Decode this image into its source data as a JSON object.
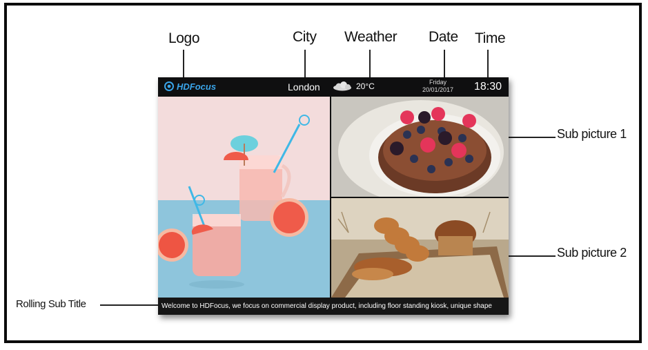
{
  "callouts": {
    "logo": "Logo",
    "city": "City",
    "weather": "Weather",
    "date": "Date",
    "time": "Time",
    "sub_picture_1": "Sub picture 1",
    "sub_picture_2": "Sub picture 2",
    "rolling_sub_title": "Rolling Sub Title"
  },
  "screen": {
    "logo_text": "HDFocus",
    "city": "London",
    "weather_icon": "cloud-icon",
    "temperature": "20°C",
    "date_day": "Friday",
    "date_value": "20/01/2017",
    "time": "18:30",
    "ticker_text": "Welcome to HDFocus, we focus on commercial display product, including floor standing kiosk, unique shape"
  },
  "colors": {
    "logo_accent": "#3aa5ea",
    "bar_background": "#0f0f10",
    "frame_border": "#0b0b0b"
  }
}
